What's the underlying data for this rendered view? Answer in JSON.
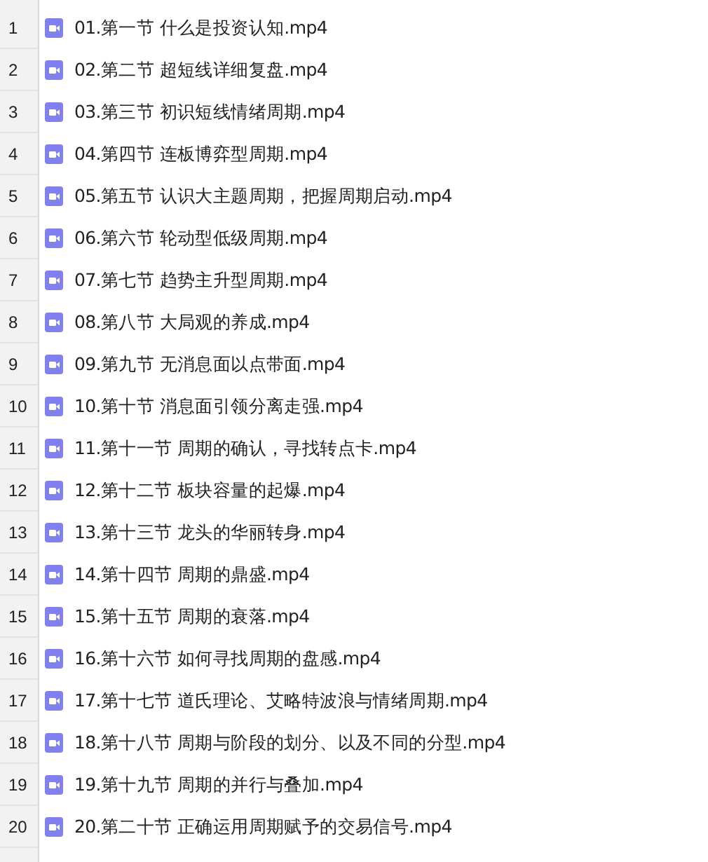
{
  "rows": [
    {
      "number": "1",
      "file": "01.第一节 什么是投资认知.mp4"
    },
    {
      "number": "2",
      "file": "02.第二节 超短线详细复盘.mp4"
    },
    {
      "number": "3",
      "file": "03.第三节 初识短线情绪周期.mp4"
    },
    {
      "number": "4",
      "file": "04.第四节 连板博弈型周期.mp4"
    },
    {
      "number": "5",
      "file": "05.第五节 认识大主题周期，把握周期启动.mp4"
    },
    {
      "number": "6",
      "file": "06.第六节 轮动型低级周期.mp4"
    },
    {
      "number": "7",
      "file": "07.第七节 趋势主升型周期.mp4"
    },
    {
      "number": "8",
      "file": "08.第八节 大局观的养成.mp4"
    },
    {
      "number": "9",
      "file": "09.第九节 无消息面以点带面.mp4"
    },
    {
      "number": "10",
      "file": "10.第十节 消息面引领分离走强.mp4"
    },
    {
      "number": "11",
      "file": "11.第十一节 周期的确认，寻找转点卡.mp4"
    },
    {
      "number": "12",
      "file": "12.第十二节 板块容量的起爆.mp4"
    },
    {
      "number": "13",
      "file": "13.第十三节 龙头的华丽转身.mp4"
    },
    {
      "number": "14",
      "file": "14.第十四节 周期的鼎盛.mp4"
    },
    {
      "number": "15",
      "file": "15.第十五节 周期的衰落.mp4"
    },
    {
      "number": "16",
      "file": "16.第十六节  如何寻找周期的盘感.mp4"
    },
    {
      "number": "17",
      "file": "17.第十七节 道氏理论、艾略特波浪与情绪周期.mp4"
    },
    {
      "number": "18",
      "file": "18.第十八节 周期与阶段的划分、以及不同的分型.mp4"
    },
    {
      "number": "19",
      "file": "19.第十九节 周期的并行与叠加.mp4"
    },
    {
      "number": "20",
      "file": "20.第二十节 正确运用周期赋予的交易信号.mp4"
    }
  ]
}
